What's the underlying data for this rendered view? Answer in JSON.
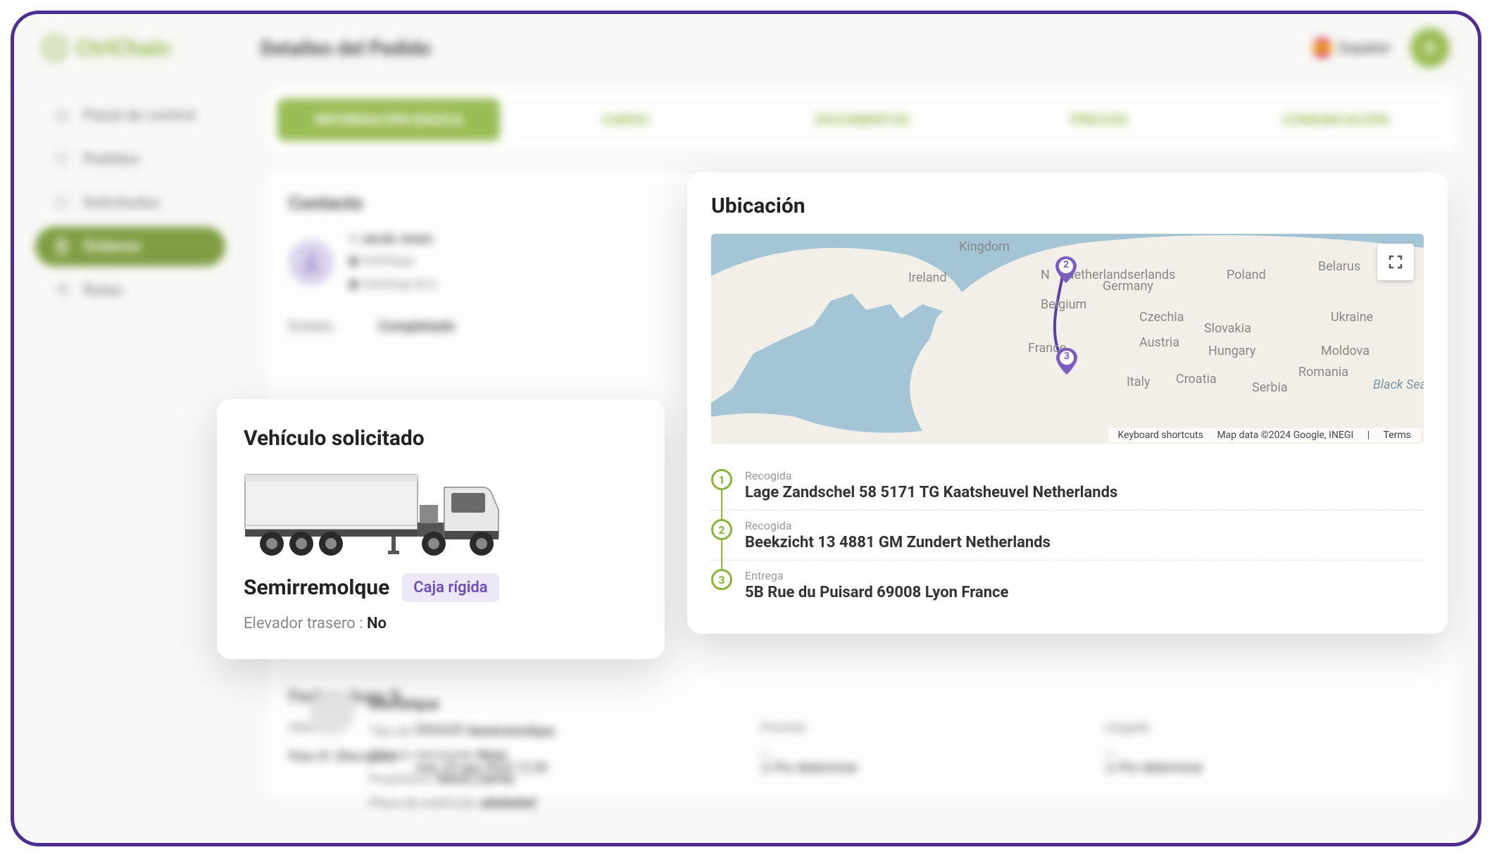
{
  "brand": "CtrlChain",
  "page_title": "Detalles del Pedido",
  "language": "Español",
  "avatar_initial": "A",
  "sidebar": {
    "items": [
      {
        "label": "Panel de control",
        "icon": "dashboard-icon"
      },
      {
        "label": "Pedidos",
        "icon": "package-icon"
      },
      {
        "label": "Solicitudes",
        "icon": "inbox-icon"
      },
      {
        "label": "Órdenes",
        "icon": "clipboard-icon",
        "active": true
      },
      {
        "label": "Rutas",
        "icon": "route-icon"
      }
    ]
  },
  "tabs": [
    "INFORMACIÓN BÁSICA",
    "CARGO",
    "DOCUMENTOS",
    "PRECIOS",
    "COMUNICACIÓN"
  ],
  "contact": {
    "title": "Contacto",
    "name": "Jacob Jones",
    "company": "CtrlChain",
    "entity": "CtrlChain B.V."
  },
  "status": {
    "label": "Estado:",
    "value": "Completado"
  },
  "vehicle_card": {
    "title": "Vehículo solicitado",
    "type": "Semirremolque",
    "body_badge": "Caja rígida",
    "lift_label": "Elevador trasero :",
    "lift_value": "No"
  },
  "location_card": {
    "title": "Ubicación",
    "map": {
      "countries": [
        "Ireland",
        "Kingdom",
        "Netherlands",
        "Belgium",
        "Germany",
        "Poland",
        "Belarus",
        "France",
        "Czechia",
        "Austria",
        "Slovakia",
        "Ukraine",
        "Hungary",
        "Moldova",
        "Italy",
        "Croatia",
        "Serbia",
        "Romania",
        "Black Sea"
      ],
      "attribution": {
        "shortcuts": "Keyboard shortcuts",
        "data": "Map data ©2024 Google, INEGI",
        "terms": "Terms"
      },
      "pins": [
        "2",
        "3"
      ]
    },
    "stops": [
      {
        "num": "1",
        "type": "Recogida",
        "address": "Lage Zandschel 58 5171 TG Kaatsheuvel Netherlands"
      },
      {
        "num": "2",
        "type": "Recogida",
        "address": "Beekzicht 13 4881 GM Zundert Netherlands"
      },
      {
        "num": "3",
        "type": "Entrega",
        "address": "5B Rue du Puisard 69008 Lyon France"
      }
    ]
  },
  "trailer": {
    "title": "Remolque",
    "rows": [
      {
        "label": "Tipo de vehículo:",
        "value": "Semirremolque"
      },
      {
        "label": "Tipo de carrocería:",
        "value": "None"
      },
      {
        "label": "Propietario:",
        "value": "Demo_Carrier"
      },
      {
        "label": "Placa de matrícula:",
        "value": "adadadad"
      }
    ]
  },
  "datetime": {
    "title": "Fecha y hora",
    "headers": [
      "Ubicación",
      "Deseado",
      "Previsto",
      "Llegada"
    ],
    "rows": [
      {
        "loc": "Para #1 (Recogida)",
        "desired_label": "Seleccionado",
        "desired": "mar, 20 ago 2024 12:30",
        "eta_label": "En",
        "eta": "Por determinar",
        "arrival_label": "En",
        "arrival": "Por determinar"
      }
    ]
  }
}
